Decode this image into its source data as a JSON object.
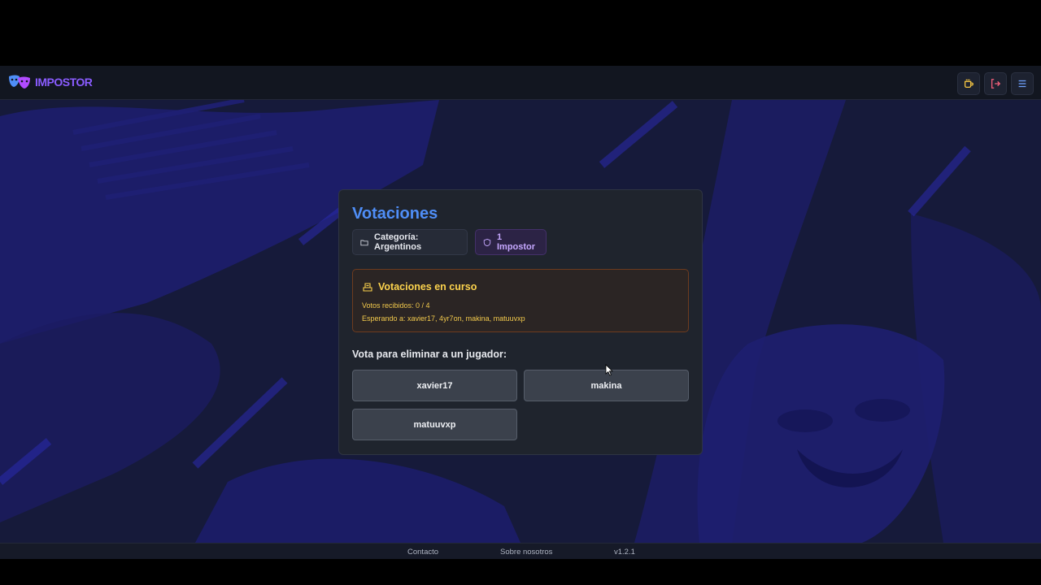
{
  "header": {
    "logo_text": "IMPOSTOR",
    "buttons": [
      {
        "icon": "cup-icon",
        "color": "#f5c542"
      },
      {
        "icon": "logout-icon",
        "color": "#f25f7a"
      },
      {
        "icon": "menu-icon",
        "color": "#6fa3ff"
      }
    ]
  },
  "card": {
    "title": "Votaciones",
    "category_chip": "Categoría: Argentinos",
    "impostor_chip": "1 Impostor",
    "status": {
      "title": "Votaciones en curso",
      "votes": "Votos recibidos: 0 / 4",
      "waiting": "Esperando a: xavier17, 4yr7on, makina, matuuvxp"
    },
    "vote_prompt": "Vota para eliminar a un jugador:",
    "players": [
      "xavier17",
      "makina",
      "matuuvxp"
    ]
  },
  "footer": {
    "contact": "Contacto",
    "about": "Sobre nosotros",
    "version": "v1.2.1"
  },
  "colors": {
    "accent_blue": "#4f8ef7",
    "impostor_purple": "#c6a8ff",
    "status_yellow": "#fcd34d",
    "background": "#161a35"
  }
}
